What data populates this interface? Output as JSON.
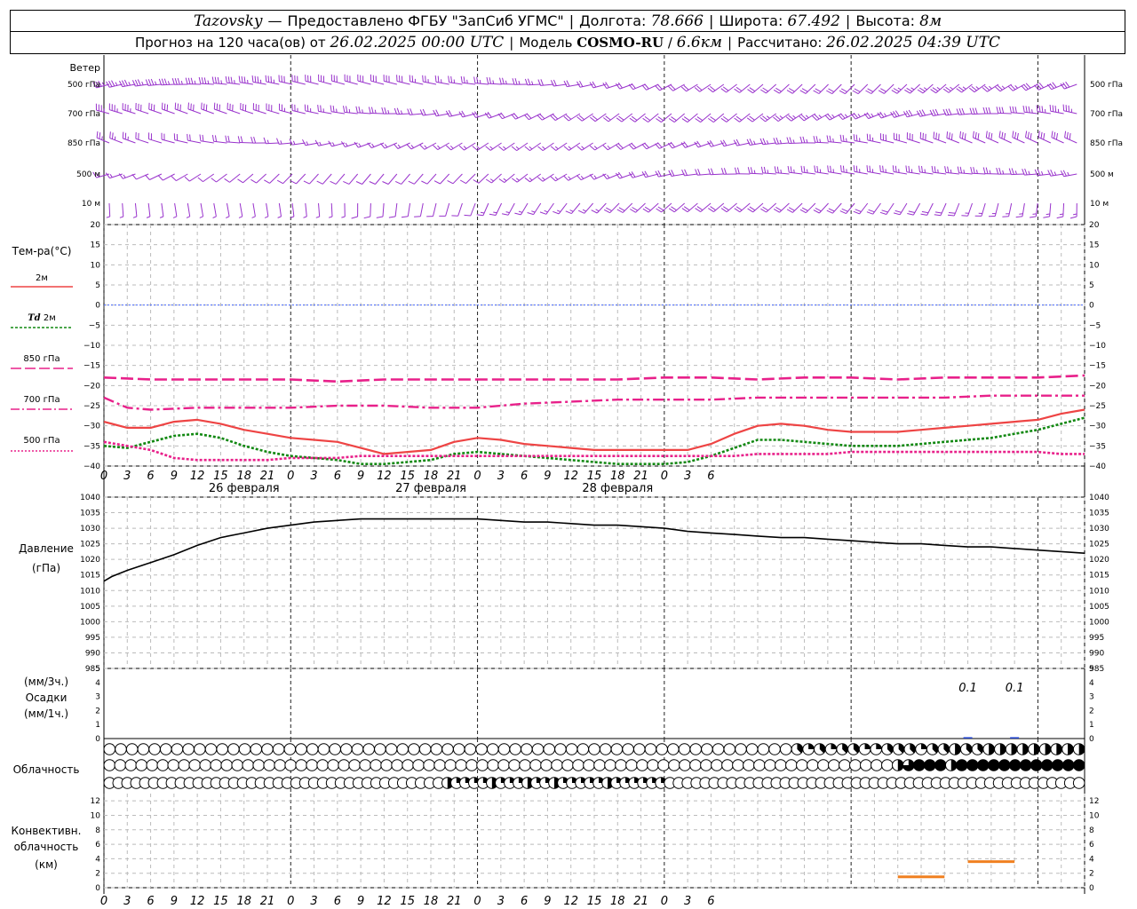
{
  "header": {
    "station": "Tazovsky",
    "provider": "Предоставлено ФГБУ \"ЗапСиб УГМС\"",
    "lon_label": "Долгота:",
    "lon": "78.666",
    "lat_label": "Широта:",
    "lat": "67.492",
    "alt_label": "Высота:",
    "alt": "8м",
    "forecast_label": "Прогноз на 120 часа(ов) от",
    "init_time": "26.02.2025 00:00 UTC",
    "model_label": "Модель",
    "model": "COSMO-RU",
    "resolution": "6.6км",
    "calc_label": "Рассчитано:",
    "calc_time": "26.02.2025 04:39 UTC"
  },
  "x_ticks": [
    "0",
    "3",
    "6",
    "9",
    "12",
    "15",
    "18",
    "21",
    "0",
    "3",
    "6",
    "9",
    "12",
    "15",
    "18",
    "21",
    "0",
    "3",
    "6",
    "9",
    "12",
    "15",
    "18",
    "21",
    "0",
    "3",
    "6"
  ],
  "day_labels": [
    "26 февраля",
    "27 февраля",
    "28 февраля"
  ],
  "colors": {
    "wind": "#9933cc",
    "t2m": "#ee4444",
    "td2m": "#118811",
    "t850": "#e8208a",
    "t700": "#e8208a",
    "t500": "#e8208a",
    "zero_line": "#4466ff",
    "pressure": "#000000",
    "convective": "#f08020",
    "precip": "#2244cc"
  },
  "wind": {
    "title": "Ветер",
    "levels": [
      "500 гПа",
      "700 гПа",
      "850 гПа",
      "500 м",
      "10 м"
    ],
    "glyph_kind": "wind-barb"
  },
  "temperature": {
    "title": "Тем-ра(°C)",
    "legend": {
      "t2m": "2м",
      "td_sym": "Td",
      "td_lvl": "2м",
      "t850": "850 гПа",
      "t700": "700 гПа",
      "t500": "500 гПа"
    }
  },
  "pressure": {
    "title": "Давление",
    "unit": "(гПа)"
  },
  "precipitation": {
    "unit3": "(мм/3ч.)",
    "title": "Осадки",
    "unit1": "(мм/1ч.)",
    "annotations": [
      {
        "hour": 111,
        "text": "0.1"
      },
      {
        "hour": 117,
        "text": "0.1"
      }
    ]
  },
  "cloud": {
    "title": "Облачность",
    "glyph_kind": "cloud-cover-circle",
    "rows": [
      {
        "step_hours": 3,
        "values_eighths": [
          0,
          0,
          0,
          0,
          0,
          0,
          0,
          0,
          0,
          0,
          0,
          0,
          0,
          0,
          0,
          0,
          0,
          0,
          0,
          0,
          0,
          0,
          0,
          0,
          0,
          0,
          0,
          0,
          0,
          0,
          0,
          0,
          0,
          0,
          0,
          0,
          0,
          0,
          0,
          0,
          0,
          0,
          0,
          0,
          0,
          0,
          0,
          0,
          0,
          0,
          0,
          0,
          0,
          0,
          0,
          0,
          0,
          0,
          0,
          0,
          0,
          3,
          2,
          3,
          2,
          3,
          3,
          2,
          2,
          3,
          3,
          3,
          2,
          3,
          3,
          4,
          3,
          3,
          4,
          4,
          4,
          4,
          4,
          4,
          4,
          4,
          4
        ]
      },
      {
        "step_hours": 3,
        "values_eighths": [
          0,
          0,
          0,
          0,
          0,
          0,
          0,
          0,
          0,
          0,
          0,
          0,
          0,
          0,
          0,
          0,
          0,
          0,
          0,
          0,
          0,
          0,
          0,
          0,
          0,
          0,
          0,
          0,
          0,
          0,
          0,
          0,
          0,
          0,
          0,
          0,
          0,
          0,
          0,
          0,
          0,
          0,
          0,
          0,
          0,
          0,
          0,
          0,
          0,
          0,
          0,
          0,
          0,
          0,
          0,
          0,
          0,
          0,
          0,
          0,
          0,
          0,
          0,
          0,
          0,
          0,
          0,
          0,
          0,
          0,
          0,
          0,
          0,
          0,
          4,
          6,
          8,
          8,
          8,
          4,
          8,
          8,
          8,
          8,
          8,
          8,
          8,
          8,
          8,
          8,
          8,
          8
        ]
      },
      {
        "step_hours": 3,
        "values_eighths": [
          0,
          0,
          0,
          0,
          0,
          0,
          0,
          0,
          0,
          0,
          0,
          0,
          0,
          0,
          0,
          0,
          0,
          0,
          0,
          0,
          0,
          0,
          0,
          0,
          0,
          0,
          0,
          0,
          0,
          0,
          0,
          0,
          0,
          0,
          0,
          0,
          0,
          0,
          4,
          2,
          2,
          2,
          2,
          4,
          2,
          2,
          2,
          4,
          2,
          2,
          4,
          2,
          2,
          2,
          2,
          2,
          4,
          2,
          2,
          2,
          2,
          2,
          2,
          0,
          0,
          0,
          0,
          0,
          0,
          0,
          0,
          0,
          0,
          0,
          0,
          0,
          0,
          0,
          0,
          0,
          0,
          0,
          0,
          0,
          0,
          0,
          0,
          0,
          0,
          0,
          0,
          0,
          0,
          0,
          0,
          0,
          0,
          0,
          0,
          0,
          0,
          0,
          0,
          0,
          0,
          0,
          0,
          0,
          0,
          0
        ]
      }
    ]
  },
  "convective": {
    "title1": "Конвективн.",
    "title2": "облачность",
    "unit": "(км)"
  },
  "chart_data": [
    {
      "type": "line",
      "panel": "temperature",
      "x_unit": "forecast hour from 26.02.2025 00:00 UTC",
      "xlim": [
        0,
        126
      ],
      "ylim": [
        -40,
        20
      ],
      "y_ticks": [
        20,
        15,
        10,
        5,
        0,
        -5,
        -10,
        -15,
        -20,
        -25,
        -30,
        -35,
        -40
      ],
      "grid": true,
      "series": [
        {
          "key": "t2m",
          "name": "2м",
          "x": [
            0,
            3,
            6,
            9,
            12,
            15,
            18,
            21,
            24,
            27,
            30,
            33,
            36,
            39,
            42,
            45,
            48,
            51,
            54,
            57,
            60,
            63,
            66,
            69,
            72,
            75,
            78,
            81,
            84,
            87,
            90,
            93,
            96,
            99,
            102,
            105,
            108,
            111,
            114,
            117,
            120,
            123,
            126
          ],
          "y": [
            -29,
            -30.5,
            -30.5,
            -29,
            -28.5,
            -29.5,
            -31,
            -32,
            -33,
            -33.5,
            -34,
            -35.5,
            -37,
            -36.5,
            -36,
            -34,
            -33,
            -33.5,
            -34.5,
            -35,
            -35.5,
            -36,
            -36,
            -36,
            -36,
            -36,
            -34.5,
            -32,
            -30,
            -29.5,
            -30,
            -31,
            -31.5,
            -31.5,
            -31.5,
            -31,
            -30.5,
            -30,
            -29.5,
            -29,
            -28.5,
            -27,
            -26
          ]
        },
        {
          "key": "td2m",
          "name": "Td 2м",
          "x": [
            0,
            3,
            6,
            9,
            12,
            15,
            18,
            21,
            24,
            27,
            30,
            33,
            36,
            39,
            42,
            45,
            48,
            51,
            54,
            57,
            60,
            63,
            66,
            69,
            72,
            75,
            78,
            81,
            84,
            87,
            90,
            93,
            96,
            99,
            102,
            105,
            108,
            111,
            114,
            117,
            120,
            123,
            126
          ],
          "y": [
            -35,
            -35.5,
            -34,
            -32.5,
            -32,
            -33,
            -35,
            -36.5,
            -37.5,
            -38,
            -38.5,
            -39.5,
            -39.5,
            -39,
            -38.5,
            -37,
            -36.5,
            -37,
            -37.5,
            -38,
            -38.5,
            -39,
            -39.5,
            -39.5,
            -39.5,
            -39,
            -37.5,
            -35.5,
            -33.5,
            -33.5,
            -34,
            -34.5,
            -35,
            -35,
            -35,
            -34.5,
            -34,
            -33.5,
            -33,
            -32,
            -31,
            -29.5,
            -28
          ]
        },
        {
          "key": "t850",
          "name": "850 гПа",
          "x": [
            0,
            6,
            12,
            18,
            24,
            30,
            36,
            42,
            48,
            54,
            60,
            66,
            72,
            78,
            84,
            90,
            96,
            102,
            108,
            114,
            120,
            126
          ],
          "y": [
            -18,
            -18.5,
            -18.5,
            -18.5,
            -18.5,
            -19,
            -18.5,
            -18.5,
            -18.5,
            -18.5,
            -18.5,
            -18.5,
            -18,
            -18,
            -18.5,
            -18,
            -18,
            -18.5,
            -18,
            -18,
            -18,
            -17.5
          ]
        },
        {
          "key": "t700",
          "name": "700 гПа",
          "x": [
            0,
            3,
            6,
            12,
            18,
            24,
            30,
            36,
            42,
            48,
            54,
            60,
            66,
            72,
            78,
            84,
            90,
            96,
            102,
            108,
            114,
            120,
            126
          ],
          "y": [
            -23,
            -25.5,
            -26,
            -25.5,
            -25.5,
            -25.5,
            -25,
            -25,
            -25.5,
            -25.5,
            -24.5,
            -24,
            -23.5,
            -23.5,
            -23.5,
            -23,
            -23,
            -23,
            -23,
            -23,
            -22.5,
            -22.5,
            -22.5
          ]
        },
        {
          "key": "t500",
          "name": "500 гПа",
          "x": [
            0,
            3,
            6,
            9,
            12,
            15,
            18,
            21,
            24,
            27,
            30,
            33,
            36,
            39,
            42,
            45,
            48,
            51,
            54,
            57,
            60,
            63,
            66,
            69,
            72,
            75,
            78,
            81,
            84,
            87,
            90,
            93,
            96,
            99,
            102,
            105,
            108,
            111,
            114,
            117,
            120,
            123,
            126
          ],
          "y": [
            -34,
            -35,
            -36,
            -38,
            -38.5,
            -38.5,
            -38.5,
            -38.5,
            -38,
            -38,
            -38,
            -37.5,
            -37.5,
            -37.5,
            -37.5,
            -37.5,
            -37.5,
            -37.5,
            -37.5,
            -37.5,
            -37.5,
            -37.5,
            -37.5,
            -37.5,
            -37.5,
            -37.5,
            -37.5,
            -37.5,
            -37,
            -37,
            -37,
            -37,
            -36.5,
            -36.5,
            -36.5,
            -36.5,
            -36.5,
            -36.5,
            -36.5,
            -36.5,
            -36.5,
            -37,
            -37
          ]
        }
      ]
    },
    {
      "type": "line",
      "panel": "pressure",
      "xlim": [
        0,
        126
      ],
      "ylim": [
        985,
        1040
      ],
      "y_ticks": [
        1040,
        1035,
        1030,
        1025,
        1020,
        1015,
        1010,
        1005,
        1000,
        995,
        990,
        985
      ],
      "grid": true,
      "series": [
        {
          "key": "pressure",
          "x": [
            0,
            1,
            3,
            6,
            9,
            12,
            15,
            18,
            21,
            24,
            27,
            30,
            33,
            36,
            39,
            42,
            45,
            48,
            51,
            54,
            57,
            60,
            63,
            66,
            69,
            72,
            75,
            78,
            81,
            84,
            87,
            90,
            93,
            96,
            99,
            102,
            105,
            108,
            111,
            114,
            117,
            120,
            123,
            126
          ],
          "y": [
            1013,
            1014.5,
            1016.5,
            1019,
            1021.5,
            1024.5,
            1027,
            1028.5,
            1030,
            1031,
            1032,
            1032.5,
            1033,
            1033,
            1033,
            1033,
            1033,
            1033,
            1032.5,
            1032,
            1032,
            1031.5,
            1031,
            1031,
            1030.5,
            1030,
            1029,
            1028.5,
            1028,
            1027.5,
            1027,
            1027,
            1026.5,
            1026,
            1025.5,
            1025,
            1025,
            1024.5,
            1024,
            1024,
            1023.5,
            1023,
            1022.5,
            1022
          ]
        }
      ]
    },
    {
      "type": "bar",
      "panel": "precipitation",
      "xlim": [
        0,
        126
      ],
      "ylim": [
        0,
        5
      ],
      "y_ticks": [
        5,
        4,
        3,
        2,
        1,
        0
      ],
      "grid": false,
      "series": [
        {
          "key": "precip",
          "x": [
            111,
            117
          ],
          "values": [
            0.1,
            0.1
          ]
        }
      ]
    },
    {
      "type": "bar",
      "panel": "convective",
      "xlim": [
        0,
        126
      ],
      "ylim": [
        0,
        13
      ],
      "y_ticks": [
        12,
        10,
        8,
        6,
        4,
        2,
        0
      ],
      "grid": true,
      "series": [
        {
          "key": "convective",
          "segments": [
            {
              "x_start": 102,
              "x_end": 108,
              "base_km": 1.5,
              "top_km": 1.5
            },
            {
              "x_start": 111,
              "x_end": 117,
              "base_km": 3.3,
              "top_km": 3.6
            }
          ]
        }
      ]
    }
  ]
}
